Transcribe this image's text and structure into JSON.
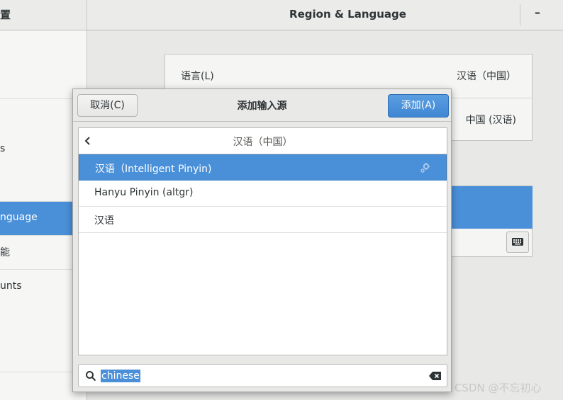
{
  "window": {
    "sidebar_title": "置",
    "title": "Region & Language",
    "minimize_glyph": "–"
  },
  "sidebar": {
    "items": [
      {
        "label": ""
      },
      {
        "label": "s"
      },
      {
        "label": "nguage"
      },
      {
        "label": "能"
      },
      {
        "label": "unts"
      }
    ]
  },
  "region_panel": {
    "language_label": "语言(L)",
    "language_value": "汉语（中国）",
    "formats_value": "中国 (汉语)"
  },
  "dialog": {
    "cancel_label": "取消(C)",
    "title": "添加输入源",
    "add_label": "添加(A)",
    "list_header": "汉语（中国）",
    "items": [
      {
        "label": "汉语（Intelligent Pinyin)",
        "selected": true
      },
      {
        "label": "Hanyu Pinyin (altgr)",
        "selected": false
      },
      {
        "label": "汉语",
        "selected": false
      }
    ],
    "search_value": "chinese"
  },
  "watermark": "CSDN @不忘初心",
  "colors": {
    "accent": "#4a90d9",
    "header_bg": "#ebebea",
    "dialog_bg": "#e8e8e7"
  }
}
